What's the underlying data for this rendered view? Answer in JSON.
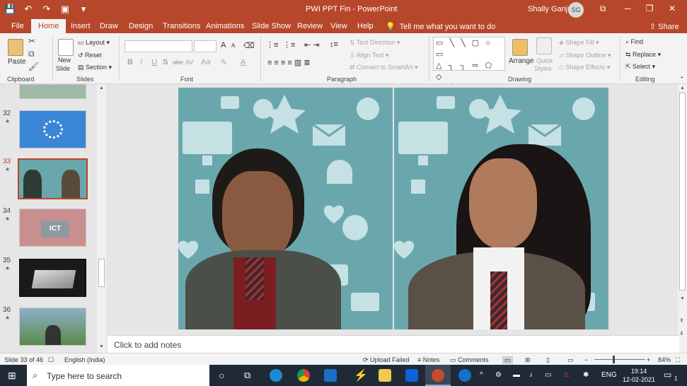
{
  "window": {
    "title": "PWI PPT Fin",
    "app": "PowerPoint",
    "user": "Shally Ganju",
    "user_initials": "SG",
    "accent": "#b7472a",
    "minimize": "─",
    "maximize": "❐",
    "close": "✕",
    "restore": "⧉"
  },
  "quick_access": {
    "save": "💾",
    "undo": "↶",
    "redo": "↷",
    "present": "▣",
    "customize": "▾"
  },
  "tabs": [
    "File",
    "Home",
    "Insert",
    "Draw",
    "Design",
    "Transitions",
    "Animations",
    "Slide Show",
    "Review",
    "View",
    "Help"
  ],
  "active_tab": "Home",
  "tell_me": "Tell me what you want to do",
  "share": "Share",
  "ribbon": {
    "clipboard": {
      "paste": "Paste",
      "label": "Clipboard"
    },
    "slides": {
      "new_slide": "New",
      "new_slide2": "Slide",
      "layout": "Layout",
      "reset": "Reset",
      "section": "Section",
      "label": "Slides"
    },
    "font": {
      "bold": "B",
      "italic": "I",
      "underline": "U",
      "strike": "S",
      "shadow": "abc",
      "spacing": "AV",
      "case": "Aa",
      "grow": "A",
      "shrink": "A",
      "label": "Font"
    },
    "paragraph": {
      "text_direction": "Text Direction",
      "align_text": "Align Text",
      "convert": "Convert to SmartArt",
      "label": "Paragraph"
    },
    "drawing": {
      "arrange": "Arrange",
      "quick": "Quick",
      "styles": "Styles",
      "shape_fill": "Shape Fill",
      "shape_outline": "Shape Outline",
      "shape_effects": "Shape Effects",
      "label": "Drawing"
    },
    "editing": {
      "find": "Find",
      "replace": "Replace",
      "select": "Select",
      "label": "Editing"
    }
  },
  "thumbnails": [
    {
      "num": "32",
      "current": false
    },
    {
      "num": "33",
      "current": true
    },
    {
      "num": "34",
      "current": false
    },
    {
      "num": "35",
      "current": false
    },
    {
      "num": "36",
      "current": false
    }
  ],
  "thumb_text": {
    "ict": "ICT"
  },
  "notes_placeholder": "Click to add notes",
  "status": {
    "slide": "Slide 33 of 46",
    "language": "English (India)",
    "upload": "Upload Failed",
    "notes": "Notes",
    "comments": "Comments",
    "zoom": "84%",
    "minus": "−",
    "plus": "+"
  },
  "taskbar": {
    "search": "Type here to search",
    "lang": "ENG",
    "time": "19:14",
    "date": "12-02-2021",
    "notif": "1"
  }
}
